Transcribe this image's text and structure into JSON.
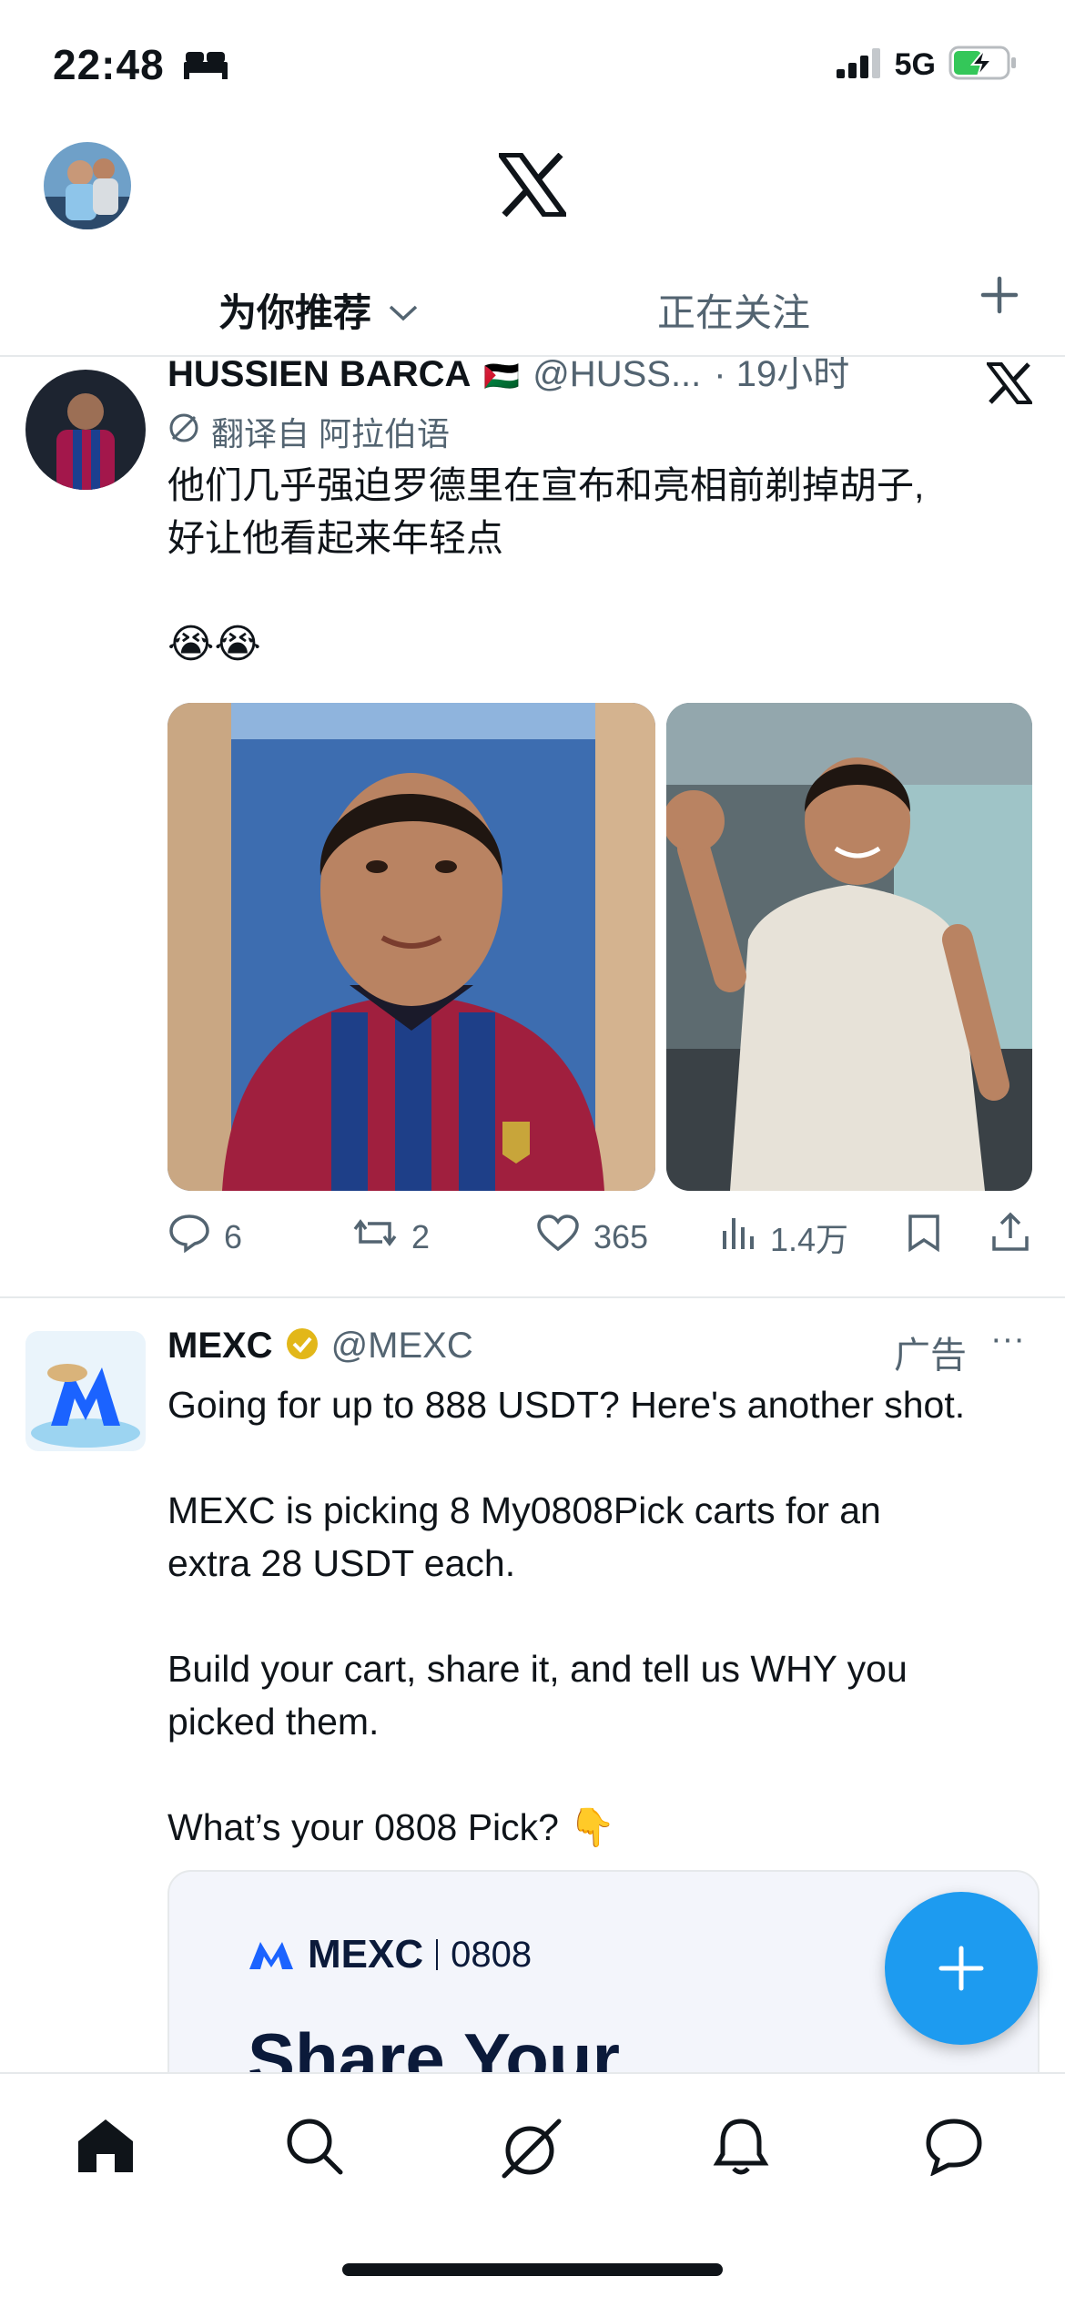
{
  "status_bar": {
    "time": "22:48",
    "network": "5G",
    "icons": [
      "bed-icon",
      "signal-icon",
      "battery-charging-icon"
    ]
  },
  "header": {
    "logo": "x-logo",
    "tabs": [
      {
        "label": "为你推荐",
        "active": true
      },
      {
        "label": "正在关注",
        "active": false
      }
    ]
  },
  "tweets": [
    {
      "display_name": "HUSSIEN BARCA",
      "flag": "🇵🇸",
      "handle": "@HUSS...",
      "time": "· 19小时",
      "translated_note": "翻译自 阿拉伯语",
      "text": "他们几乎强迫罗德里在宣布和亮相前剃掉胡子,\n好让他看起来年轻点",
      "emoji": "😭😭",
      "actions": {
        "replies": "6",
        "retweets": "2",
        "likes": "365",
        "views": "1.4万"
      }
    },
    {
      "display_name": "MEXC",
      "handle": "@MEXC",
      "ad_label": "广告",
      "more": "···",
      "text": "Going for up to 888 USDT? Here's another shot.\n\nMEXC is picking 8 My0808Pick carts for an\nextra 28 USDT each.\n\nBuild your cart, share it, and tell us WHY you\npicked them.\n\nWhat’s your 0808 Pick? 👇",
      "card": {
        "brand": "MEXC",
        "tag": "0808",
        "headline": "Share Your"
      }
    }
  ],
  "colors": {
    "accent": "#1d9bf0",
    "text": "#0f1419",
    "muted": "#536471",
    "divider": "#e6e9eb"
  }
}
